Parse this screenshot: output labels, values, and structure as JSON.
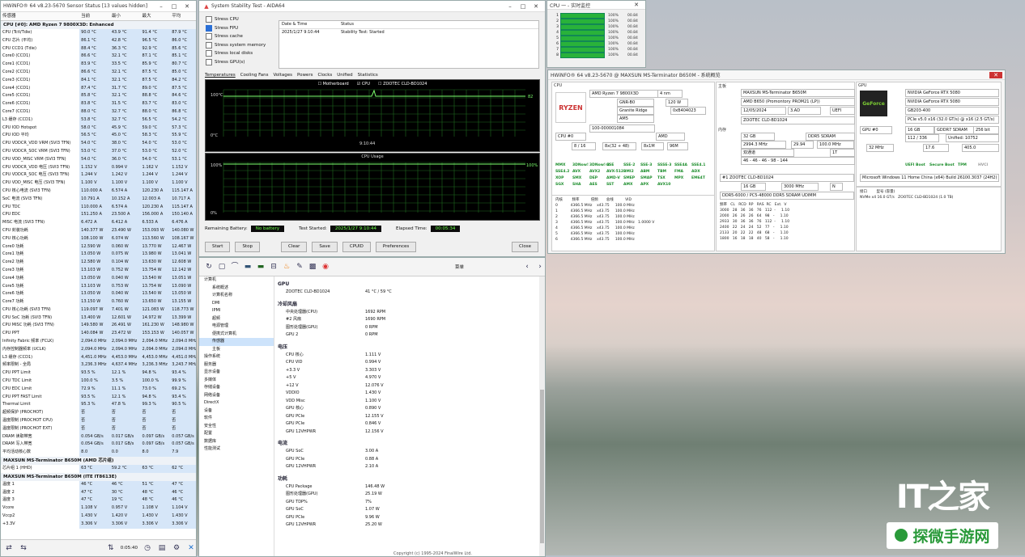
{
  "hwinfo": {
    "title": "HWiNFO® 64 v8.23-5670 Sensor Status [13 values hidden]",
    "columns": [
      "传感器",
      "当前",
      "最小",
      "最大",
      "平均"
    ],
    "section1": "CPU [#0]: AMD Ryzen 7 9800X3D: Enhanced",
    "rows": [
      [
        "CPU (Tctl/Tdie)",
        "90.0 °C",
        "43.9 °C",
        "91.4 °C",
        "87.9 °C"
      ],
      [
        "CPU 芯片 (平均)",
        "86.1 °C",
        "42.8 °C",
        "96.5 °C",
        "86.0 °C"
      ],
      [
        "CPU CCD1 (Tdie)",
        "88.4 °C",
        "36.3 °C",
        "92.9 °C",
        "85.6 °C"
      ],
      [
        "Core0 (CCD1)",
        "86.6 °C",
        "32.1 °C",
        "87.1 °C",
        "85.1 °C"
      ],
      [
        "Core1 (CCD1)",
        "83.9 °C",
        "33.5 °C",
        "85.9 °C",
        "80.7 °C"
      ],
      [
        "Core2 (CCD1)",
        "86.6 °C",
        "32.1 °C",
        "87.5 °C",
        "85.0 °C"
      ],
      [
        "Core3 (CCD1)",
        "84.1 °C",
        "32.1 °C",
        "87.5 °C",
        "84.2 °C"
      ],
      [
        "Core4 (CCD1)",
        "87.4 °C",
        "31.7 °C",
        "89.0 °C",
        "87.5 °C"
      ],
      [
        "Core5 (CCD1)",
        "85.8 °C",
        "32.1 °C",
        "88.8 °C",
        "84.6 °C"
      ],
      [
        "Core6 (CCD1)",
        "83.8 °C",
        "31.5 °C",
        "83.7 °C",
        "83.0 °C"
      ],
      [
        "Core7 (CCD1)",
        "88.0 °C",
        "32.7 °C",
        "88.0 °C",
        "86.8 °C"
      ],
      [
        "L3 缓存 (CCD1)",
        "53.8 °C",
        "32.7 °C",
        "56.5 °C",
        "54.2 °C"
      ],
      [
        "CPU IOD Hotspot",
        "58.0 °C",
        "45.9 °C",
        "59.0 °C",
        "57.3 °C"
      ],
      [
        "CPU IOD 平均",
        "56.5 °C",
        "45.0 °C",
        "58.3 °C",
        "55.9 °C"
      ],
      [
        "CPU VDDCR_VDD VRM (SVI3 TFN)",
        "54.0 °C",
        "38.0 °C",
        "54.0 °C",
        "53.0 °C"
      ],
      [
        "CPU VDDCR_SOC VRM (SVI3 TFN)",
        "53.0 °C",
        "37.0 °C",
        "53.0 °C",
        "52.0 °C"
      ],
      [
        "CPU VDD_MISC VRM (SVI3 TFN)",
        "54.0 °C",
        "36.0 °C",
        "54.0 °C",
        "53.1 °C"
      ],
      [
        "CPU VDDCR_VDD 电压 (SVI3 TFN)",
        "1.152 V",
        "0.994 V",
        "1.162 V",
        "1.152 V"
      ],
      [
        "CPU VDDCR_SOC 电压 (SVI3 TFN)",
        "1.244 V",
        "1.242 V",
        "1.244 V",
        "1.244 V"
      ],
      [
        "CPU VDD_MISC 电压 (SVI3 TFN)",
        "1.100 V",
        "1.100 V",
        "1.100 V",
        "1.100 V"
      ],
      [
        "CPU 核心电流 (SVI3 TFN)",
        "110.000 A",
        "6.574 A",
        "120.230 A",
        "115.147 A"
      ],
      [
        "SoC 电流 (SVI3 TFN)",
        "10.791 A",
        "10.152 A",
        "12.003 A",
        "10.717 A"
      ],
      [
        "CPU TDC",
        "110.000 A",
        "6.574 A",
        "120.230 A",
        "115.147 A"
      ],
      [
        "CPU EDC",
        "151.250 A",
        "23.500 A",
        "156.000 A",
        "150.140 A"
      ],
      [
        "MISC 电流 (SVI3 TFN)",
        "6.472 A",
        "6.412 A",
        "6.533 A",
        "6.476 A"
      ],
      [
        "CPU 封装功耗",
        "140.377 W",
        "23.490 W",
        "153.093 W",
        "140.080 W"
      ],
      [
        "CPU 核心功耗",
        "108.100 W",
        "6.074 W",
        "113.560 W",
        "108.167 W"
      ],
      [
        "Core0 功耗",
        "12.590 W",
        "0.060 W",
        "13.770 W",
        "12.467 W"
      ],
      [
        "Core1 功耗",
        "13.050 W",
        "0.075 W",
        "13.980 W",
        "13.041 W"
      ],
      [
        "Core2 功耗",
        "12.580 W",
        "0.104 W",
        "13.630 W",
        "12.608 W"
      ],
      [
        "Core3 功耗",
        "13.103 W",
        "0.752 W",
        "13.754 W",
        "12.142 W"
      ],
      [
        "Core4 功耗",
        "13.050 W",
        "0.040 W",
        "13.540 W",
        "13.051 W"
      ],
      [
        "Core5 功耗",
        "13.103 W",
        "0.753 W",
        "13.754 W",
        "13.090 W"
      ],
      [
        "Core6 功耗",
        "13.050 W",
        "0.040 W",
        "13.540 W",
        "13.050 W"
      ],
      [
        "Core7 功耗",
        "13.150 W",
        "0.760 W",
        "13.650 W",
        "13.155 W"
      ],
      [
        "CPU 核心功耗 (SVI3 TFN)",
        "119.097 W",
        "7.401 W",
        "121.083 W",
        "118.773 W"
      ],
      [
        "CPU SoC 功耗 (SVI3 TFN)",
        "13.400 W",
        "12.601 W",
        "14.972 W",
        "13.399 W"
      ],
      [
        "CPU MISC 功耗 (SVI3 TFN)",
        "149.580 W",
        "26.491 W",
        "161.230 W",
        "148.980 W"
      ],
      [
        "CPU PPT",
        "140.084 W",
        "23.472 W",
        "153.153 W",
        "140.057 W"
      ],
      [
        "Infinity Fabric 频率 (FCLK)",
        "2,094.0 MHz",
        "2,094.0 MHz",
        "2,094.0 MHz",
        "2,094.0 MHz"
      ],
      [
        "内存控制器频率 (UCLK)",
        "2,094.0 MHz",
        "2,094.0 MHz",
        "2,094.0 MHz",
        "2,094.0 MHz"
      ],
      [
        "L3 缓存 (CCD1)",
        "4,451.0 MHz",
        "4,453.0 MHz",
        "4,453.0 MHz",
        "4,451.0 MHz"
      ],
      [
        "频率限制 - 全局",
        "3,236.3 MHz",
        "4,637.4 MHz",
        "3,236.3 MHz",
        "3,243.7 MHz"
      ],
      [
        "CPU PPT Limit",
        "93.5 %",
        "12.1 %",
        "94.8 %",
        "93.4 %"
      ],
      [
        "CPU TDC Limit",
        "100.0 %",
        "3.5 %",
        "100.0 %",
        "99.9 %"
      ],
      [
        "CPU EDC Limit",
        "72.9 %",
        "11.1 %",
        "73.0 %",
        "69.2 %"
      ],
      [
        "CPU PPT FAST Limit",
        "93.5 %",
        "12.1 %",
        "94.8 %",
        "93.4 %"
      ],
      [
        "Thermal Limit",
        "95.3 %",
        "47.8 %",
        "99.3 %",
        "90.5 %"
      ],
      [
        "超频保护 (PROCHOT)",
        "否",
        "否",
        "否",
        "否"
      ],
      [
        "温度限制 (PROCHOT CPU)",
        "否",
        "否",
        "否",
        "否"
      ],
      [
        "温度限制 (PROCHOT EXT)",
        "否",
        "否",
        "否",
        "否"
      ],
      [
        "DRAM 读取带宽",
        "0.054 GB/s",
        "0.017 GB/s",
        "0.097 GB/s",
        "0.057 GB/s"
      ],
      [
        "DRAM 写入带宽",
        "0.054 GB/s",
        "0.017 GB/s",
        "0.097 GB/s",
        "0.057 GB/s"
      ],
      [
        "平均活动核心数",
        "8.0",
        "0.0",
        "8.0",
        "7.9"
      ]
    ],
    "section2": "MAXSUN MS-Terminator B650M (AMD 芯片组)",
    "rows2": [
      [
        "芯片组 1 (HHD)",
        "63 °C",
        "59.2 °C",
        "63 °C",
        "62 °C"
      ]
    ],
    "section3": "MAXSUN MS-Terminator B650M (ITE IT8613E)",
    "rows3": [
      [
        "温度 1",
        "46 °C",
        "46 °C",
        "51 °C",
        "47 °C"
      ],
      [
        "温度 2",
        "47 °C",
        "30 °C",
        "48 °C",
        "46 °C"
      ],
      [
        "温度 3",
        "47 °C",
        "19 °C",
        "48 °C",
        "46 °C"
      ],
      [
        "Vcore",
        "1.108 V",
        "0.957 V",
        "1.108 V",
        "1.104 V"
      ],
      [
        "Vccp2",
        "1.430 V",
        "1.420 V",
        "1.430 V",
        "1.430 V"
      ],
      [
        "+3.3V",
        "3.306 V",
        "3.306 V",
        "3.306 V",
        "3.306 V"
      ]
    ],
    "footer_time": "0:05:40"
  },
  "stability": {
    "title": "System Stability Test - AIDA64",
    "checks": [
      {
        "label": "Stress CPU",
        "on": false
      },
      {
        "label": "Stress FPU",
        "on": true
      },
      {
        "label": "Stress cache",
        "on": false
      },
      {
        "label": "Stress system memory",
        "on": false
      },
      {
        "label": "Stress local disks",
        "on": false
      },
      {
        "label": "Stress GPU(s)",
        "on": false
      }
    ],
    "table_headers": [
      "Date & Time",
      "Status"
    ],
    "table_row": [
      "2025/1/27 9:10:44",
      "Stability Test: Started"
    ],
    "tabs": [
      "Temperatures",
      "Cooling Fans",
      "Voltages",
      "Powers",
      "Clocks",
      "Unified",
      "Statistics"
    ],
    "legend": [
      "Motherboard",
      "CPU",
      "ZOOTEC CLD-BD1024"
    ],
    "graph1": {
      "ytop": "100°C",
      "ybot": "0°C",
      "time": "9:10:44",
      "val": "82"
    },
    "graph2": {
      "title": "CPU Usage",
      "ytop": "100%",
      "ybot": "0%",
      "val": "100%"
    },
    "remaining_label": "Remaining Battery:",
    "remaining_value": "No battery",
    "started_label": "Test Started:",
    "started_value": "2025/1/27 9:10:44",
    "elapsed_label": "Elapsed Time:",
    "elapsed_value": "00:05:34",
    "buttons": [
      "Start",
      "Stop",
      "Clear",
      "Save",
      "CPUID",
      "Preferences",
      "Close"
    ]
  },
  "cpuqueue": {
    "title": "CPU 一 - 实时监控",
    "rows": [
      {
        "n": "1",
        "p": "100%",
        "q": "00.84"
      },
      {
        "n": "2",
        "p": "100%",
        "q": "00.84"
      },
      {
        "n": "3",
        "p": "100%",
        "q": "00.84"
      },
      {
        "n": "4",
        "p": "100%",
        "q": "00.84"
      },
      {
        "n": "5",
        "p": "100%",
        "q": "00.84"
      },
      {
        "n": "6",
        "p": "100%",
        "q": "00.84"
      },
      {
        "n": "7",
        "p": "100%",
        "q": "00.84"
      },
      {
        "n": "8",
        "p": "100%",
        "q": "00.84"
      }
    ]
  },
  "aida": {
    "menu": "菜单",
    "tree": [
      "计算机",
      "系统概述",
      "计算机名称",
      "DMI",
      "IPMI",
      "超频",
      "电源管理",
      "便携式计算机",
      "传感器",
      "主板",
      "操作系统",
      "服务器",
      "显示设备",
      "多媒体",
      "存储设备",
      "网络设备",
      "DirectX",
      "设备",
      "软件",
      "安全性",
      "配置",
      "数据库",
      "性能测试"
    ],
    "sel": "传感器",
    "groups": [
      {
        "title": "GPU",
        "items": [
          [
            "ZOOTEC CLD-BD1024",
            "41 °C / 59 °C"
          ]
        ]
      },
      {
        "title": "冷却风扇",
        "items": [
          [
            "中央处理器(CPU)",
            "1692 RPM"
          ],
          [
            "#2 风扇",
            "1690 RPM"
          ],
          [
            "图形处理器(GPU)",
            "0 RPM"
          ],
          [
            "GPU 2",
            "0 RPM"
          ]
        ]
      },
      {
        "title": "电压",
        "items": [
          [
            "CPU 核心",
            "1.111 V"
          ],
          [
            "CPU VID",
            "0.994 V"
          ],
          [
            "+3.3 V",
            "3.303 V"
          ],
          [
            "+5 V",
            "4.970 V"
          ],
          [
            "+12 V",
            "12.076 V"
          ],
          [
            "VDDIO",
            "1.430 V"
          ],
          [
            "VDD Misc",
            "1.100 V"
          ],
          [
            "GPU 核心",
            "0.890 V"
          ],
          [
            "GPU PCIe",
            "12.155 V"
          ],
          [
            "GPU PCIe",
            "0.846 V"
          ],
          [
            "GPU 12VHPWR",
            "12.156 V"
          ]
        ]
      },
      {
        "title": "电流",
        "items": [
          [
            "GPU SoC",
            "3.00 A"
          ],
          [
            "GPU PCIe",
            "0.88 A"
          ],
          [
            "GPU 12VHPWR",
            "2.10 A"
          ]
        ]
      },
      {
        "title": "功耗",
        "items": [
          [
            "CPU Package",
            "146.48 W"
          ],
          [
            "图形处理器(GPU)",
            "25.19 W"
          ],
          [
            "GPU TDP%",
            "7%"
          ],
          [
            "GPU SoC",
            "1.07 W"
          ],
          [
            "GPU PCIe",
            "9.96 W"
          ],
          [
            "GPU 12VHPWR",
            "25.20 W"
          ]
        ]
      }
    ],
    "copyright": "Copyright (c) 1995-2024 FinalWire Ltd."
  },
  "summary": {
    "title": "HWiNFO® 64 v8.23-5670 @ MAXSUN MS-Terminator B650M - 系统概览",
    "cpu_name": "AMD Ryzen 7 9800X3D",
    "cpu_nm": "4 nm",
    "cpu_stepping": "GNR-B0",
    "cpu_tdp": "120 W",
    "cpu_codename": "Granite Ridge",
    "cpu_mcu": "0xB404023",
    "cpu_socket": "AM5",
    "cpu_sspec": "100-000001084",
    "cpu_brand": "AMD",
    "cpu_select": "CPU #0",
    "cpu_cores": "8 / 16",
    "cpu_l1": "8x(32 + 48)",
    "cpu_l2": "8x1M",
    "cpu_l3": "96M",
    "features": [
      "MMX",
      "3DNow!",
      "3DNow!-2",
      "SSE",
      "SSE-2",
      "SSE-3",
      "SSSE-3",
      "SSE4A",
      "SSE4.1",
      "SSE4.2",
      "AVX",
      "AVX2",
      "AVX-512",
      "BMI2",
      "ABM",
      "TBM",
      "FMA",
      "ADX",
      "XOP",
      "SMX",
      "DEP",
      "AMD-V",
      "SMEP",
      "SMAP",
      "TSX",
      "MPX",
      "EM64T",
      "SGX",
      "SHA",
      "AES",
      "SST",
      "AMX",
      "APX",
      "AVX10"
    ],
    "mb_name": "MAXSUN MS-Terminator B650M",
    "mb_chipset": "AMD B650 (Promontory PROM21 (LP))",
    "mb_bios_date": "12/05/2024",
    "mb_bios_ver": "3.AD",
    "mb_bios_type": "UEFI",
    "drive": "ZOOTEC CLD-BD1024",
    "mem_size": "32 GB",
    "mem_type": "DDR5 SDRAM",
    "mem_freq": "2994.3 MHz",
    "mem_mult": "29.94",
    "mem_ratio": "100.0 MHz",
    "mem_mode": "双通道",
    "mem_cr": "1T",
    "mem_timing": "46  -  46  -  46  -  98  -  144",
    "mem_module": "DDR5-6000 / PC5-48000 DDR5 SDRAM UDIMM",
    "mem_module_size": "16 GB",
    "mem_module_speed": "3000 MHz",
    "mem_ecc": "N",
    "mem_type2": "SRDIMM",
    "gpu_name": "NVIDIA GeForce RTX 5080",
    "gpu_name2": "NVIDIA GeForce RTX 5080",
    "gpu_chip": "GB203-400",
    "gpu_pcie": "PCIe v5.0 x16 (32.0 GT/s) @ x16 (2.5 GT/s)",
    "gpu_select": "GPU #0",
    "gpu_mem": "16 GB",
    "gpu_mem_type": "GDDR7 SDRAM",
    "gpu_bus": "256 bit",
    "gpu_rops": "112 / 336",
    "gpu_sh": "Unified: 10752",
    "gpu_clock": "32 MHz",
    "gpu_core": "17.6",
    "gpu_mem_clk": "405.0",
    "gpu_uefi": "UEFI Boot",
    "gpu_secure": "Secure Boot",
    "gpu_tpm": "TPM",
    "gpu_hvci": "HVCI",
    "os": "Microsoft Windows 11 Home China (x64) Build 26100.3037 (24H2)"
  },
  "watermark": {
    "main": "IT之家",
    "sub": "探微手游网"
  }
}
